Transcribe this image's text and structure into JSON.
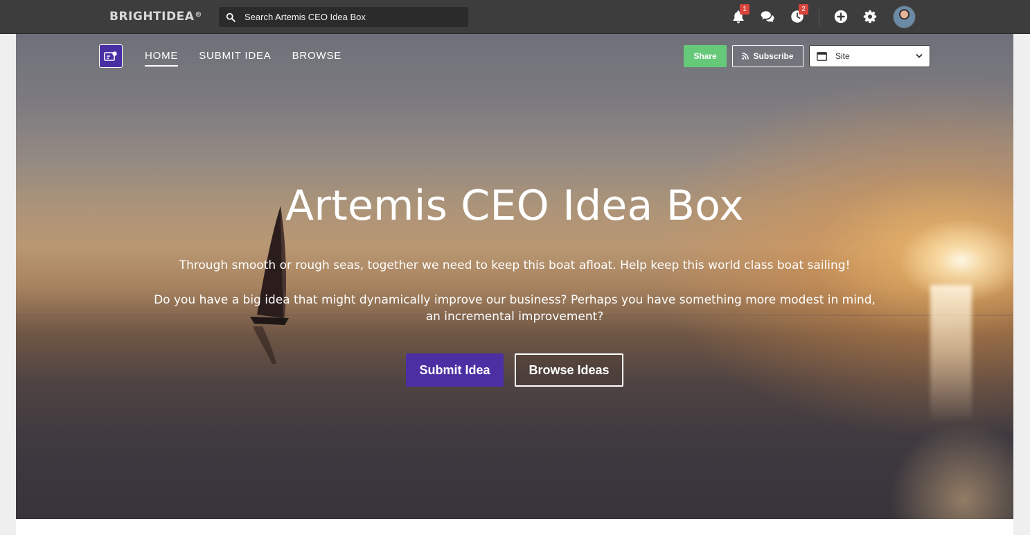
{
  "topbar": {
    "brand": "BRIGHTIDEA",
    "brand_mark": "®",
    "search_placeholder": "Search Artemis CEO Idea Box",
    "notifications_count": "1",
    "activity_count": "2",
    "icons": [
      "search-icon",
      "bell-icon",
      "chat-icon",
      "clock-icon",
      "plus-circle-icon",
      "gear-icon",
      "avatar"
    ]
  },
  "hero_nav": {
    "items": [
      {
        "label": "HOME",
        "active": true
      },
      {
        "label": "SUBMIT IDEA",
        "active": false
      },
      {
        "label": "BROWSE",
        "active": false
      }
    ],
    "share_label": "Share",
    "subscribe_label": "Subscribe",
    "site_select_value": "Site"
  },
  "hero": {
    "title": "Artemis CEO Idea Box",
    "paragraph1": "Through smooth or rough seas, together we need to keep this boat afloat. Help keep this world class boat sailing!",
    "paragraph2": "Do you have a big idea that might dynamically improve our business? Perhaps you have something more modest in mind, an incremental improvement?",
    "primary_cta": "Submit Idea",
    "secondary_cta": "Browse Ideas"
  },
  "colors": {
    "topbar_bg": "#3d3d3d",
    "primary": "#4b2fa3",
    "share_green": "#66c97a",
    "badge_red": "#d9453b"
  }
}
